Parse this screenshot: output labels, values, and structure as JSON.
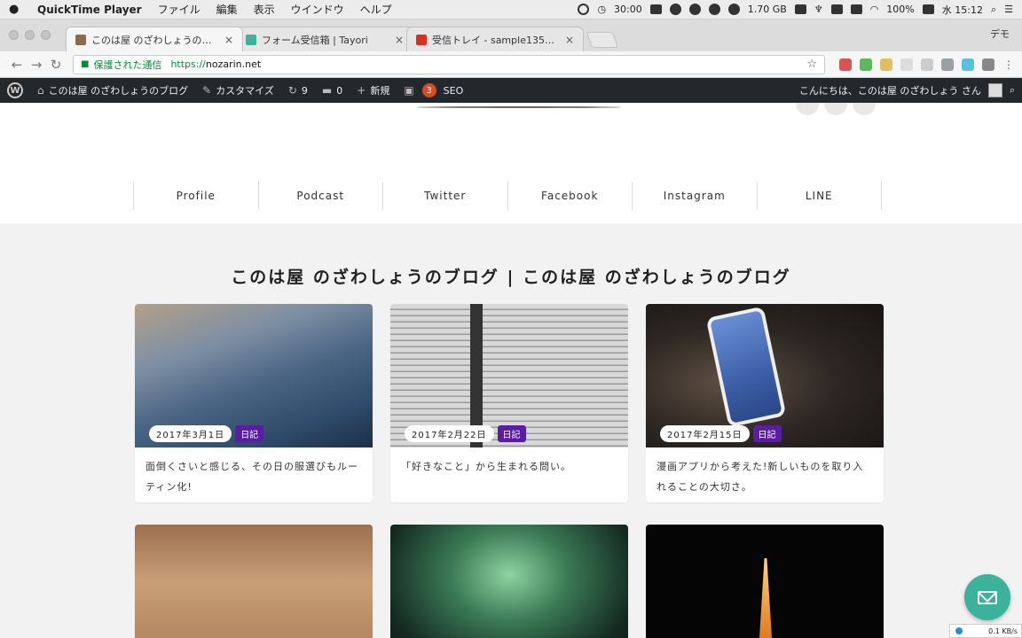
{
  "menubar": {
    "app_name": "QuickTime Player",
    "menus": [
      "ファイル",
      "編集",
      "表示",
      "ウインドウ",
      "ヘルプ"
    ],
    "timer": "30:00",
    "memory": "1.70 GB",
    "battery": "100%",
    "clock": "水 15:12"
  },
  "browser": {
    "tabs": [
      {
        "title": "このは屋 のざわしょうのブログ",
        "favicon_color": "#8b6b4a"
      },
      {
        "title": "フォーム受信箱 | Tayori",
        "favicon_color": "#3bb39a"
      },
      {
        "title": "受信トレイ - sample13590gm",
        "favicon_color": "#d93025"
      }
    ],
    "profile_label": "デモ",
    "secure_label": "保護された通信",
    "url_scheme": "https://",
    "url_host": "nozarin.net"
  },
  "adminbar": {
    "site_name": "このは屋 のざわしょうのブログ",
    "customize": "カスタマイズ",
    "updates": "9",
    "comments": "0",
    "new": "新規",
    "seo_badge": "3",
    "seo": "SEO",
    "greeting": "こんにちは、このは屋 のざわしょう さん"
  },
  "nav": [
    "Profile",
    "Podcast",
    "Twitter",
    "Facebook",
    "Instagram",
    "LINE"
  ],
  "page": {
    "heading": "このは屋 のざわしょうのブログ | このは屋 のざわしょうのブログ"
  },
  "posts": [
    {
      "date": "2017年3月1日",
      "category": "日記",
      "title": "面倒くさいと感じる、その日の服選びもルーティン化!"
    },
    {
      "date": "2017年2月22日",
      "category": "日記",
      "title": "「好きなこと」から生まれる問い。"
    },
    {
      "date": "2017年2月15日",
      "category": "日記",
      "title": "漫画アプリから考えた!新しいものを取り入れることの大切さ。"
    },
    {
      "date": "",
      "category": "",
      "title": ""
    },
    {
      "date": "",
      "category": "",
      "title": ""
    },
    {
      "date": "",
      "category": "",
      "title": ""
    }
  ],
  "netspeed": "0.1 KB/s",
  "colors": {
    "category": "#5a1e9e",
    "fab": "#3bb39a",
    "adminbar": "#23282d"
  }
}
